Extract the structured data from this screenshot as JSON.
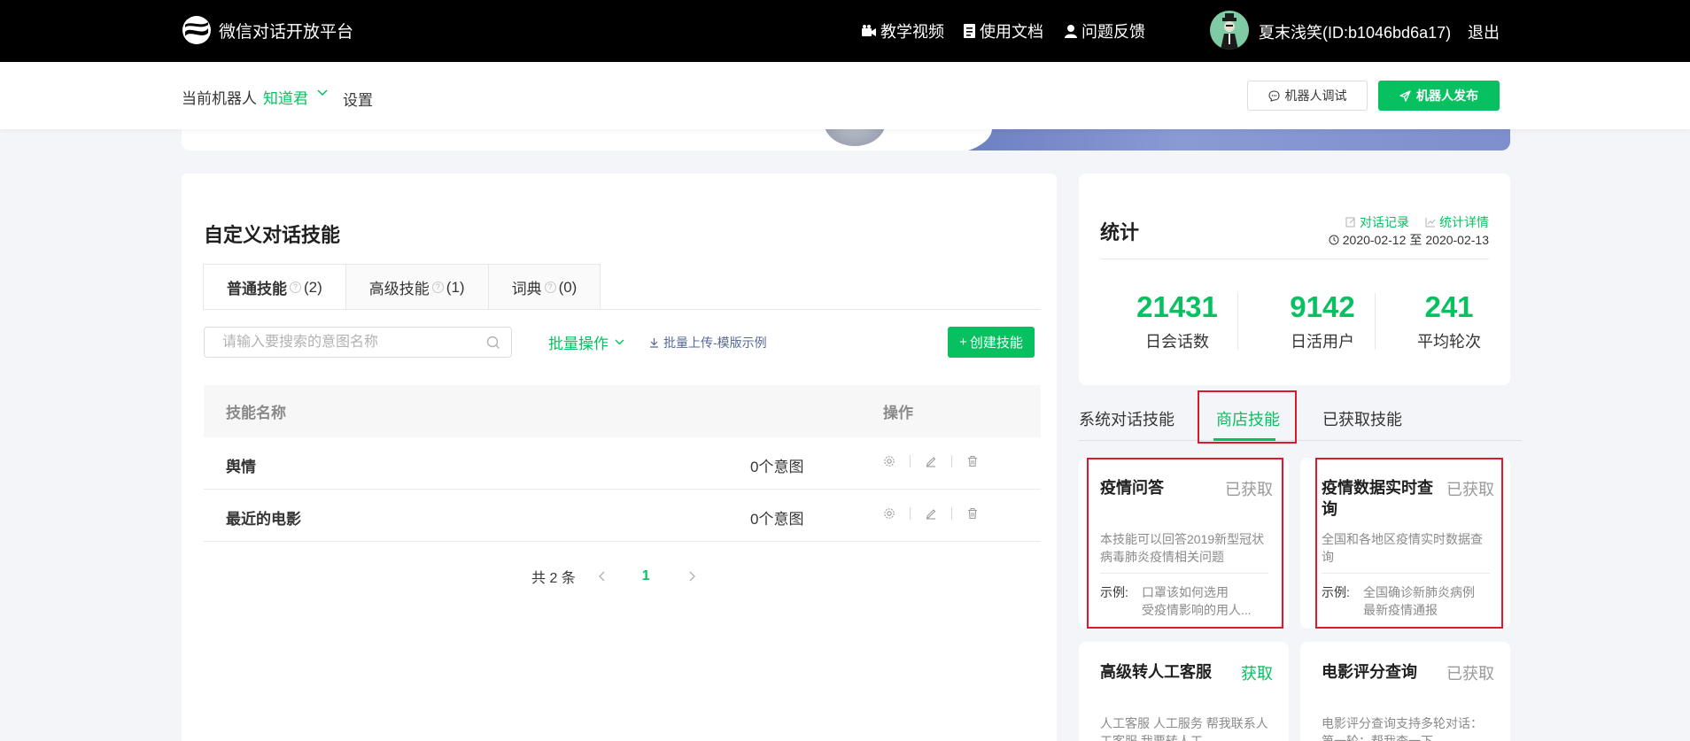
{
  "app": {
    "title": "微信对话开放平台",
    "nav": [
      {
        "icon": "video-icon",
        "label": "教学视频"
      },
      {
        "icon": "document-icon",
        "label": "使用文档"
      },
      {
        "icon": "user-icon",
        "label": "问题反馈"
      }
    ],
    "user_name": "夏末浅笑(ID:b1046bd6a17)",
    "logout": "退出"
  },
  "subheader": {
    "robot_label": "当前机器人",
    "robot_name": "知道君",
    "settings": "设置",
    "debug_button": "机器人调试",
    "publish_button": "机器人发布"
  },
  "custom_skills": {
    "title": "自定义对话技能",
    "tabs": [
      {
        "label": "普通技能",
        "count": "(2)"
      },
      {
        "label": "高级技能",
        "count": "(1)"
      },
      {
        "label": "词典",
        "count": "(0)"
      }
    ],
    "search_placeholder": "请输入要搜索的意图名称",
    "batch_op": "批量操作",
    "batch_upload": "批量上传-模版示例",
    "create_button": "创建技能",
    "columns": [
      "技能名称",
      "操作"
    ],
    "rows": [
      {
        "name": "舆情",
        "intents": "0个意图"
      },
      {
        "name": "最近的电影",
        "intents": "0个意图"
      }
    ],
    "pager": {
      "total": "共 2 条",
      "current": "1"
    }
  },
  "stats": {
    "title": "统计",
    "link_records": "对话记录",
    "link_details": "统计详情",
    "date_from": "2020-02-12",
    "date_sep": "至",
    "date_to": "2020-02-13",
    "items": [
      {
        "value": "21431",
        "label": "日会话数"
      },
      {
        "value": "9142",
        "label": "日活用户"
      },
      {
        "value": "241",
        "label": "平均轮次"
      }
    ]
  },
  "skill_store": {
    "tabs": [
      "系统对话技能",
      "商店技能",
      "已获取技能"
    ],
    "active_tab": 1,
    "example_label": "示例:",
    "cards": [
      {
        "title": "疫情问答",
        "status": "已获取",
        "desc": "本技能可以回答2019新型冠状病毒肺炎疫情相关问题",
        "examples": [
          "口罩该如何选用",
          "受疫情影响的用人..."
        ]
      },
      {
        "title": "疫情数据实时查询",
        "status": "已获取",
        "desc": "全国和各地区疫情实时数据查询",
        "examples": [
          "全国确诊新肺炎病例",
          "最新疫情通报"
        ]
      },
      {
        "title": "高级转人工客服",
        "status": "获取",
        "desc": "人工客服 人工服务 帮我联系人工客服 我要转人工",
        "examples": []
      },
      {
        "title": "电影评分查询",
        "status": "已获取",
        "desc": "电影评分查询支持多轮对话：第一轮：帮我查一下",
        "examples": []
      }
    ]
  },
  "colors": {
    "accent": "#07c160",
    "highlight_box": "#e0182e",
    "topbar": "#000000"
  }
}
